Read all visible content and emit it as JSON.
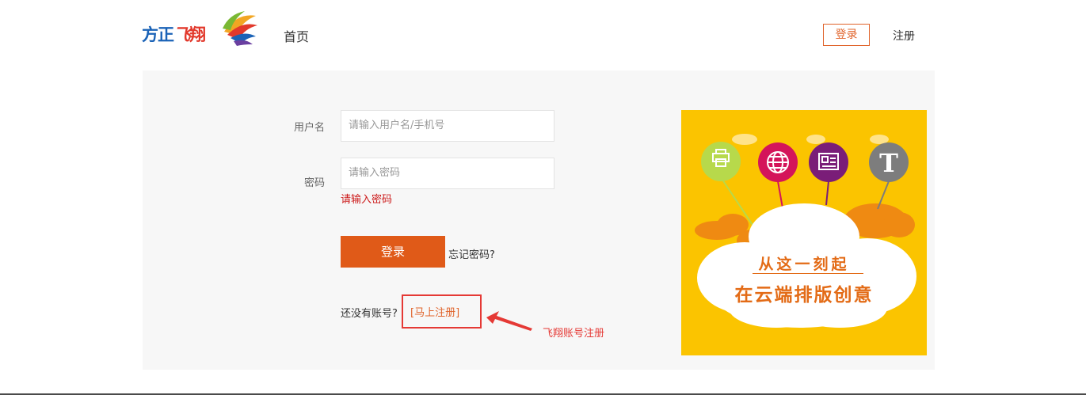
{
  "header": {
    "logo_text_1": "方正",
    "logo_text_2": "飞",
    "logo_text_3": "翔",
    "nav_home": "首页",
    "login_button": "登录",
    "register_link": "注册"
  },
  "form": {
    "username_label": "用户名",
    "username_placeholder": "请输入用户名/手机号",
    "password_label": "密码",
    "password_placeholder": "请输入密码",
    "password_error": "请输入密码",
    "login_button": "登录",
    "forgot_link": "忘记密码?",
    "no_account_text": "还没有账号?",
    "register_now_link": "[马上注册]"
  },
  "annotation": {
    "text": "飞翔账号注册",
    "color": "#e53935"
  },
  "banner": {
    "line1": "从这一刻起",
    "line2": "在云端排版创意",
    "icons": [
      "printer-icon",
      "globe-icon",
      "document-icon",
      "text-icon"
    ]
  },
  "colors": {
    "accent": "#e05a18",
    "banner_bg": "#fbc400",
    "error": "#cc1a1a"
  }
}
